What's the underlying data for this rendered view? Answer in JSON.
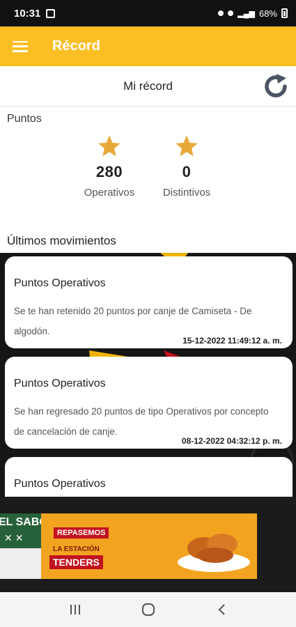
{
  "status_bar": {
    "time": "10:31",
    "battery": "68%"
  },
  "app_bar": {
    "title": "Récord",
    "icons": [
      "menu-icon"
    ]
  },
  "sub_header": {
    "title": "Mi récord",
    "icons": [
      "refresh-icon"
    ]
  },
  "points": {
    "label": "Puntos",
    "operativos": {
      "value": "280",
      "caption": "Operativos"
    },
    "distintivos": {
      "value": "0",
      "caption": "Distintivos"
    },
    "star_color": "#E8A838"
  },
  "movements": {
    "label": "Últimos movimientos",
    "items": [
      {
        "title": "Puntos Operativos",
        "description": "Se te han retenido 20 puntos por canje de Camiseta - De algodón.",
        "date": "15-12-2022 11:49:12 a. m."
      },
      {
        "title": "Puntos Operativos",
        "description": "Se han regresado 20 puntos de tipo Operativos por concepto de cancelación de canje.",
        "date": "08-12-2022 04:32:12 p. m."
      },
      {
        "title": "Puntos Operativos",
        "description": "",
        "date": ""
      }
    ]
  },
  "ad": {
    "left_text": "EL SABO",
    "tag1": "REPASEMOS",
    "tag2": "LA ESTACIÓN",
    "tag3": "TENDERS"
  },
  "colors": {
    "accent": "#FBBF24",
    "status_bar": "#111111",
    "background_dark": "#161616"
  }
}
